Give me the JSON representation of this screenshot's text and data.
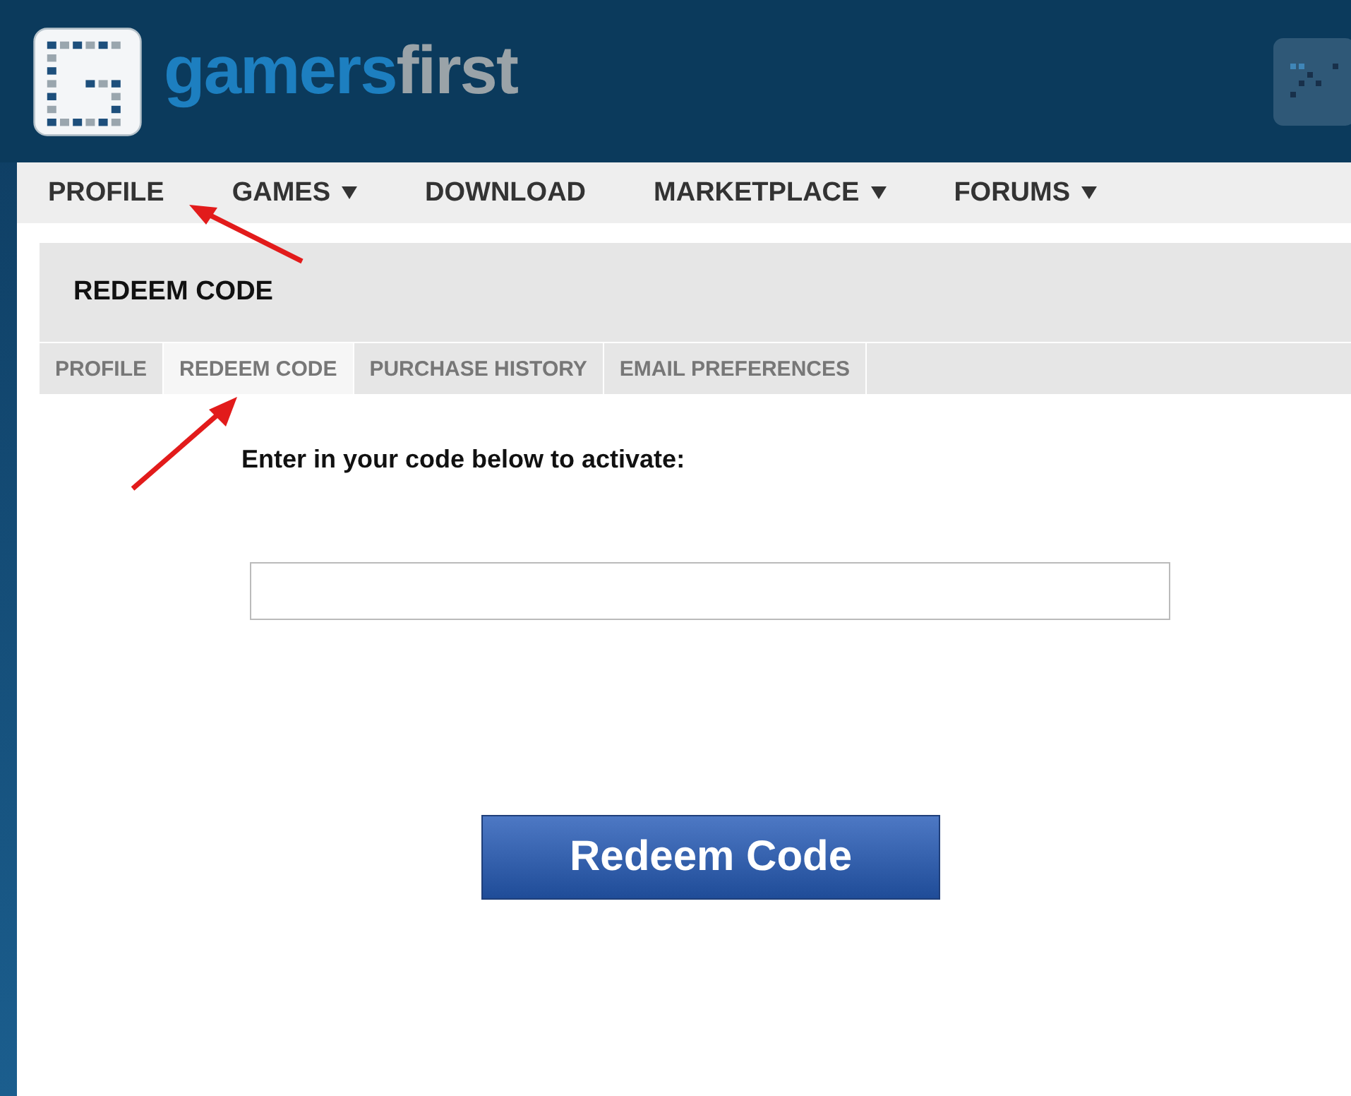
{
  "logo": {
    "part_1": "gamers",
    "part_2": "first"
  },
  "nav": [
    {
      "label": "PROFILE",
      "dropdown": false
    },
    {
      "label": "GAMES",
      "dropdown": true
    },
    {
      "label": "DOWNLOAD",
      "dropdown": false
    },
    {
      "label": "MARKETPLACE",
      "dropdown": true
    },
    {
      "label": "FORUMS",
      "dropdown": true
    }
  ],
  "page_title": "REDEEM CODE",
  "tabs": [
    {
      "label": "PROFILE",
      "selected": false
    },
    {
      "label": "REDEEM CODE",
      "selected": true
    },
    {
      "label": "PURCHASE HISTORY",
      "selected": false
    },
    {
      "label": "EMAIL PREFERENCES",
      "selected": false
    }
  ],
  "prompt": "Enter in your code below to activate:",
  "submit_button": "Redeem Code"
}
